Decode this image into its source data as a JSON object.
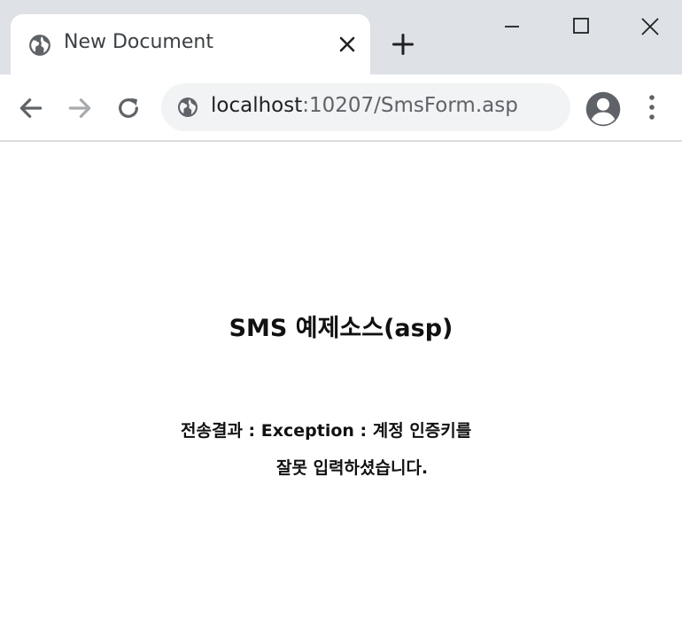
{
  "browser": {
    "tab": {
      "title": "New Document",
      "favicon": "globe-icon",
      "close_icon": "close-icon"
    },
    "new_tab_icon": "plus-icon",
    "window_controls": {
      "minimize_icon": "minimize-icon",
      "maximize_icon": "maximize-icon",
      "close_icon": "close-icon"
    },
    "toolbar": {
      "back_icon": "arrow-left-icon",
      "forward_icon": "arrow-right-icon",
      "reload_icon": "reload-icon",
      "profile_icon": "account-circle-icon",
      "menu_icon": "kebab-menu-icon"
    },
    "address": {
      "site_icon": "globe-icon",
      "host": "localhost",
      "path": ":10207/SmsForm.asp"
    },
    "colors": {
      "tabstrip": "#dee1e6",
      "omnibox": "#f1f3f4",
      "icon": "#5f6368"
    }
  },
  "page": {
    "heading": "SMS 예제소스(asp)",
    "result_label": "전송결과 :",
    "result_line1": "Exception : 계정 인증키를",
    "result_line2": "잘못 입력하셨습니다."
  }
}
